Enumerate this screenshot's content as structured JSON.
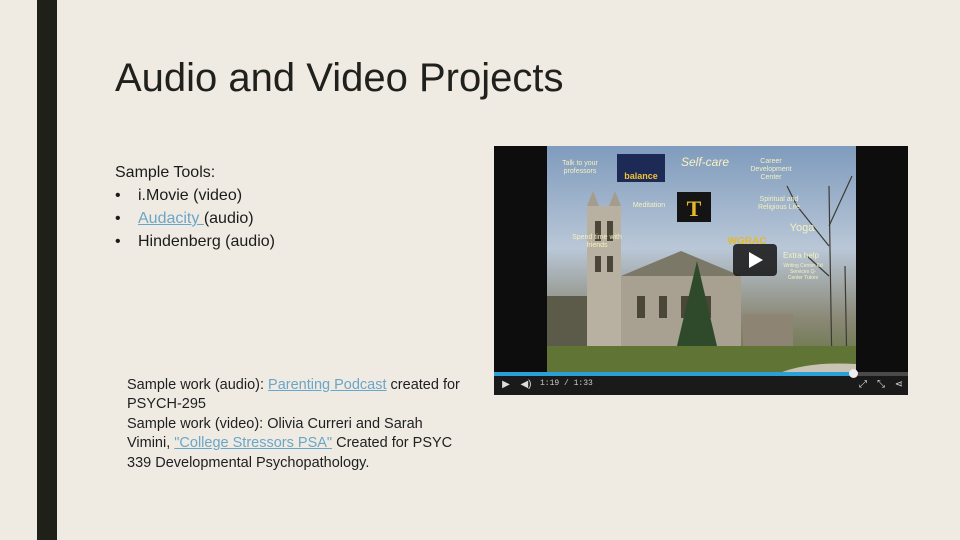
{
  "slide": {
    "title": "Audio and Video Projects",
    "tools_heading": "Sample Tools:",
    "tools": [
      {
        "name": "i.Movie",
        "suffix": " (video)",
        "is_link": false
      },
      {
        "name": "Audacity ",
        "suffix": "(audio)",
        "is_link": true
      },
      {
        "name": "Hindenberg",
        "suffix": " (audio)",
        "is_link": false
      }
    ],
    "bullet": "•",
    "samples": {
      "audio_prefix": "Sample work (audio): ",
      "audio_link": "Parenting Podcast",
      "audio_suffix": " created for PSYCH-295",
      "video_prefix": "Sample work (video): Olivia Curreri and Sarah Vimini, ",
      "video_link": "\"College Stressors PSA\"",
      "video_suffix": " Created for PSYC 339 Developmental Psychopathology."
    },
    "colors": {
      "link": "#6aa6c8",
      "bar": "#1f2018",
      "background": "#efebe3",
      "progress": "#2aa0d6"
    }
  },
  "video": {
    "time_display": "1:19 / 1:33",
    "progress_fraction": 0.867,
    "overlay": {
      "talk": "Talk to your professors",
      "balance": "balance",
      "selfcare": "Self-care",
      "career": "Career Development Center",
      "meditation": "Meditation",
      "spiritual": "Spiritual and Religious Life",
      "spend": "Spend time with friends",
      "yoga": "Yoga",
      "wgrac": "WGRAC",
      "extra": "Extra help",
      "extra_detail": "Writing Center Ed Services Q-Center Tutors"
    },
    "icons": [
      "play-icon",
      "volume-icon",
      "fullscreen-icon",
      "share-icon"
    ]
  }
}
